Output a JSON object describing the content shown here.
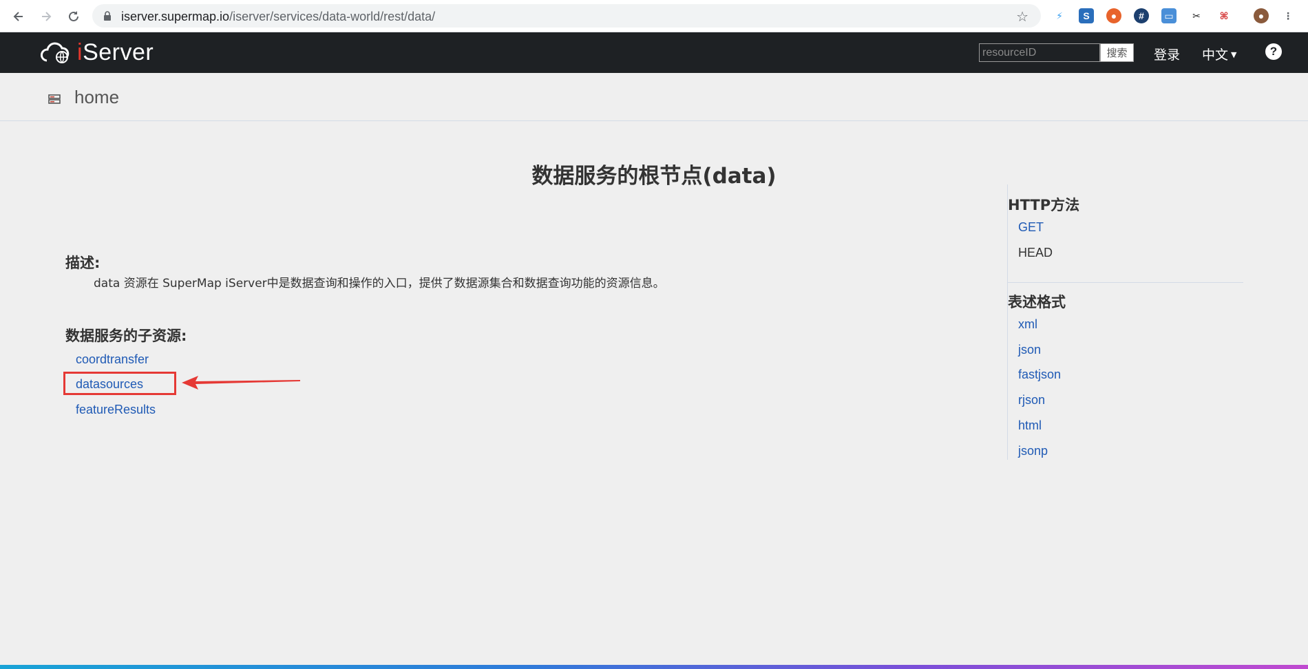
{
  "browser": {
    "url_host": "iserver.supermap.io",
    "url_path": "/iserver/services/data-world/rest/data/"
  },
  "header": {
    "logo_text_i": "i",
    "logo_text_rest": "Server",
    "search_placeholder": "resourceID",
    "search_button": "搜索",
    "login": "登录",
    "language": "中文",
    "help": "?"
  },
  "breadcrumb": {
    "label": "home"
  },
  "main": {
    "title": "数据服务的根节点(data)",
    "description_heading": "描述:",
    "description_text": "data 资源在 SuperMap iServer中是数据查询和操作的入口，提供了数据源集合和数据查询功能的资源信息。",
    "children_heading": "数据服务的子资源:",
    "children": [
      {
        "label": "coordtransfer"
      },
      {
        "label": "datasources"
      },
      {
        "label": "featureResults"
      }
    ]
  },
  "side": {
    "methods_heading": "HTTP方法",
    "methods": [
      {
        "label": "GET"
      },
      {
        "label": "HEAD"
      }
    ],
    "formats_heading": "表述格式",
    "formats": [
      {
        "label": "xml"
      },
      {
        "label": "json"
      },
      {
        "label": "fastjson"
      },
      {
        "label": "rjson"
      },
      {
        "label": "html"
      },
      {
        "label": "jsonp"
      }
    ]
  },
  "colors": {
    "link": "#1f5ab5",
    "header_bg": "#1e2124",
    "highlight": "#e53935"
  }
}
